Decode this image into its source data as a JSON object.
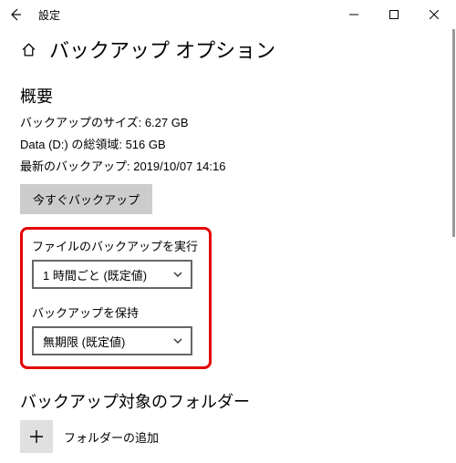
{
  "titlebar": {
    "title": "設定"
  },
  "page": {
    "title": "バックアップ オプション"
  },
  "overview": {
    "heading": "概要",
    "size_line": "バックアップのサイズ: 6.27 GB",
    "drive_line": "Data (D:) の総領域: 516 GB",
    "last_line": "最新のバックアップ: 2019/10/07 14:16",
    "backup_now": "今すぐバックアップ"
  },
  "frequency": {
    "label": "ファイルのバックアップを実行",
    "value": "1 時間ごと (既定値)"
  },
  "retention": {
    "label": "バックアップを保持",
    "value": "無期限 (既定値)"
  },
  "folders": {
    "heading": "バックアップ対象のフォルダー",
    "add_label": "フォルダーの追加"
  }
}
